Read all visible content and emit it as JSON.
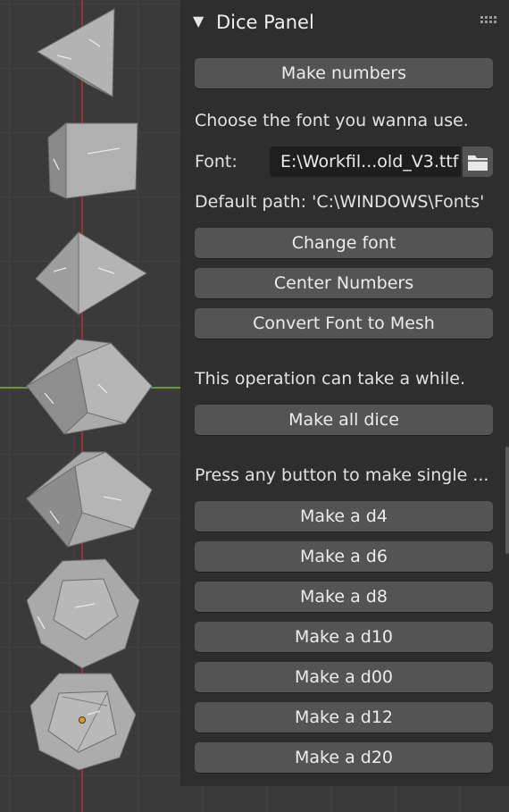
{
  "panel": {
    "title": "Dice Panel",
    "collapse_icon": "triangle-down-icon",
    "make_numbers_label": "Make numbers",
    "font_hint": "Choose the font you wanna use.",
    "font_label": "Font:",
    "font_value": "E:\\Workfil...old_V3.ttf",
    "default_path": "Default path: 'C:\\WINDOWS\\Fonts'",
    "change_font_label": "Change font",
    "center_numbers_label": "Center Numbers",
    "convert_font_label": "Convert Font to Mesh",
    "operation_note": "This operation can take a while.",
    "make_all_label": "Make all dice",
    "single_hint": "Press any button to make single ...",
    "dice_buttons": [
      "Make a d4",
      "Make a d6",
      "Make a d8",
      "Make a d10",
      "Make a d00",
      "Make a d12",
      "Make a d20"
    ]
  },
  "colors": {
    "viewport_bg": "#3a3a3a",
    "panel_bg": "#2e2e2e",
    "button_bg": "#545454",
    "field_bg": "#1e1e1e",
    "y_axis": "#9c2f3c",
    "x_axis": "#6e9a2a",
    "dice": "#a9a9a9"
  }
}
